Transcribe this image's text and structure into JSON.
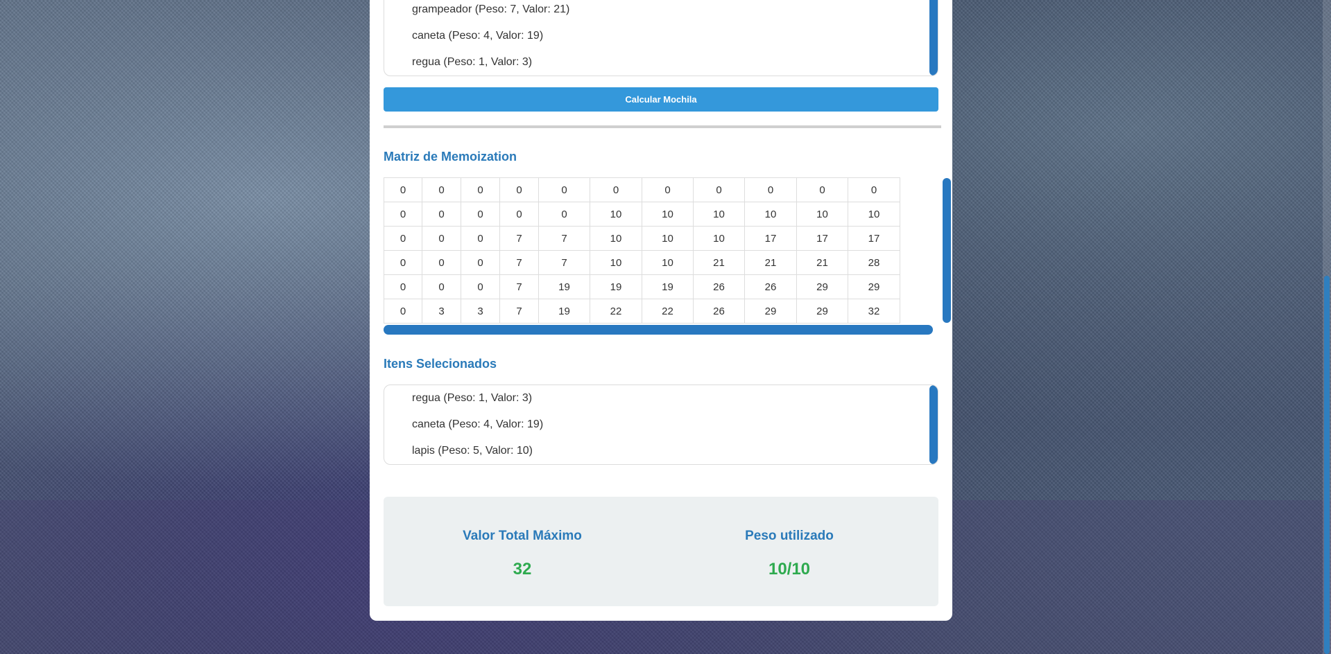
{
  "items_list": [
    {
      "label": "grampeador (Peso: 7, Valor: 21)"
    },
    {
      "label": "caneta (Peso: 4, Valor: 19)"
    },
    {
      "label": "regua (Peso: 1, Valor: 3)"
    }
  ],
  "calculate_button": {
    "label": "Calcular Mochila"
  },
  "memo": {
    "title": "Matriz de Memoization",
    "rows": [
      [
        "0",
        "0",
        "0",
        "0",
        "0",
        "0",
        "0",
        "0",
        "0",
        "0",
        "0"
      ],
      [
        "0",
        "0",
        "0",
        "0",
        "0",
        "10",
        "10",
        "10",
        "10",
        "10",
        "10"
      ],
      [
        "0",
        "0",
        "0",
        "7",
        "7",
        "10",
        "10",
        "10",
        "17",
        "17",
        "17"
      ],
      [
        "0",
        "0",
        "0",
        "7",
        "7",
        "10",
        "10",
        "21",
        "21",
        "21",
        "28"
      ],
      [
        "0",
        "0",
        "0",
        "7",
        "19",
        "19",
        "19",
        "26",
        "26",
        "29",
        "29"
      ],
      [
        "0",
        "3",
        "3",
        "7",
        "19",
        "22",
        "22",
        "26",
        "29",
        "29",
        "32"
      ]
    ]
  },
  "selected": {
    "title": "Itens Selecionados",
    "items": [
      {
        "label": "regua (Peso: 1, Valor: 3)"
      },
      {
        "label": "caneta (Peso: 4, Valor: 19)"
      },
      {
        "label": "lapis (Peso: 5, Valor: 10)"
      }
    ]
  },
  "summary": {
    "max_value_label": "Valor Total Máximo",
    "max_value": "32",
    "weight_label": "Peso utilizado",
    "weight_value": "10/10"
  },
  "colors": {
    "accent": "#2a7ab9",
    "button": "#3498db",
    "success": "#2eaa4f",
    "scrollbar": "#2878c0"
  }
}
